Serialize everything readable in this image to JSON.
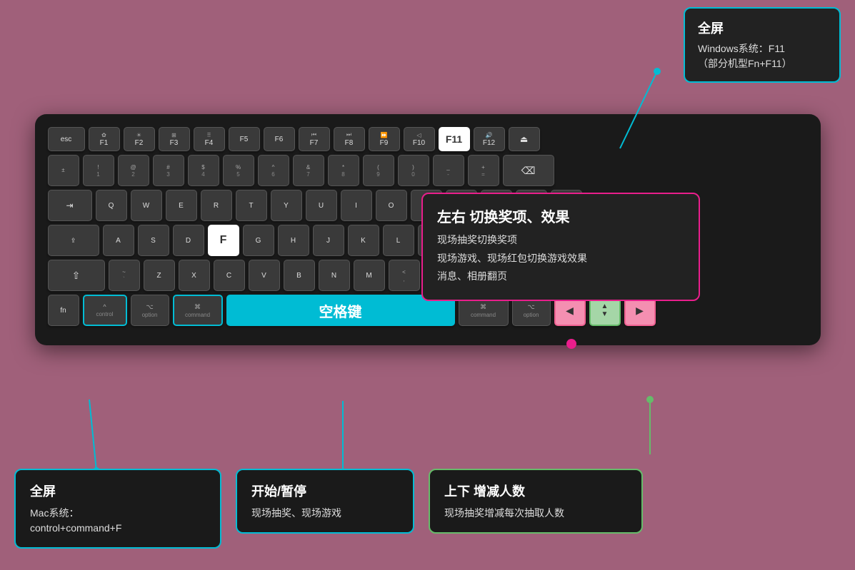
{
  "tooltip_win": {
    "title": "全屏",
    "line1": "Windows系统：F11",
    "line2": "（部分机型Fn+F11）"
  },
  "tooltip_lr": {
    "title": "左右 切换奖项、效果",
    "item1": "现场抽奖切换奖项",
    "item2": "现场游戏、现场红包切换游戏效果",
    "item3": "消息、相册翻页"
  },
  "tooltip_mac": {
    "title": "全屏",
    "line1": "Mac系统：",
    "line2": "control+command+F"
  },
  "tooltip_space": {
    "title": "开始/暂停",
    "body": "现场抽奖、现场游戏"
  },
  "tooltip_updown": {
    "title": "上下 增减人数",
    "body": "现场抽奖增减每次抽取人数"
  },
  "keys": {
    "esc": "esc",
    "f1": "F1",
    "f2": "F2",
    "f3": "F3",
    "f4": "F4",
    "f5": "F5",
    "f6": "F6",
    "f7": "F7",
    "f8": "F8",
    "f9": "F9",
    "f10": "F10",
    "f11": "F11",
    "f12": "F12",
    "space": "空格键",
    "fn": "fn",
    "control": "control",
    "option": "option",
    "command": "command",
    "option_r": "option",
    "command_r": "command",
    "f_key": "F"
  }
}
